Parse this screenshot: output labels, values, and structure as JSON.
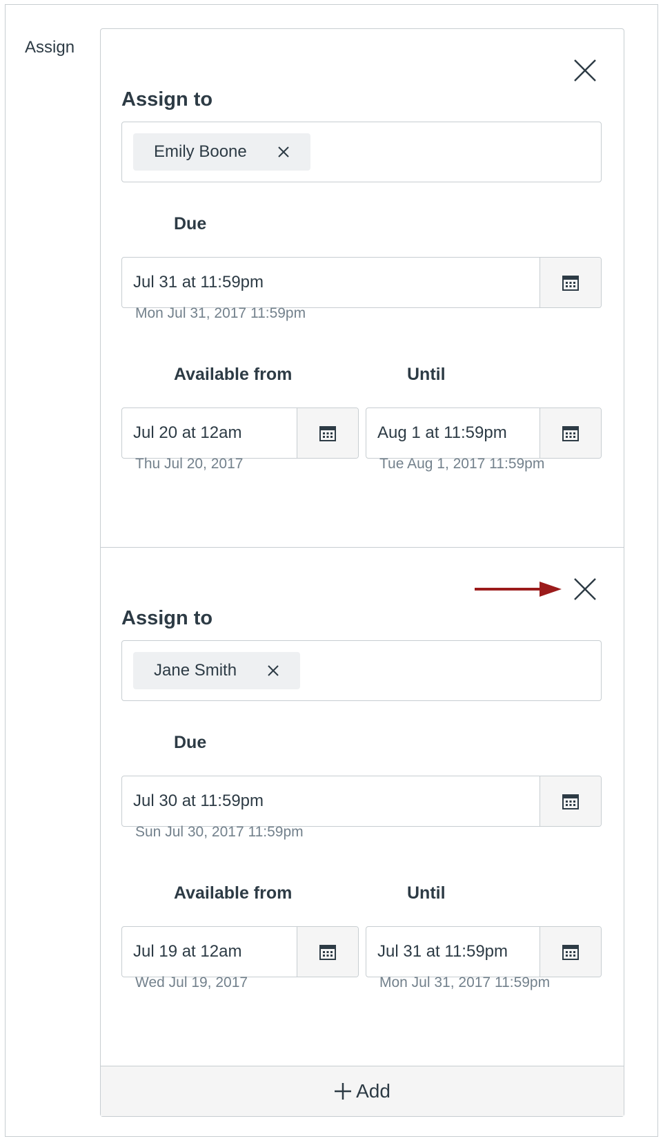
{
  "section_label": "Assign",
  "assignments": [
    {
      "title": "Assign to",
      "assignee": "Emily Boone",
      "due_label": "Due",
      "due_value": "Jul 31 at 11:59pm",
      "due_hint": "Mon Jul 31, 2017 11:59pm",
      "available_label": "Available from",
      "available_value": "Jul 20 at 12am",
      "available_hint": "Thu Jul 20, 2017",
      "until_label": "Until",
      "until_value": "Aug 1 at 11:59pm",
      "until_hint": "Tue Aug 1, 2017 11:59pm"
    },
    {
      "title": "Assign to",
      "assignee": "Jane Smith",
      "due_label": "Due",
      "due_value": "Jul 30 at 11:59pm",
      "due_hint": "Sun Jul 30, 2017 11:59pm",
      "available_label": "Available from",
      "available_value": "Jul 19 at 12am",
      "available_hint": "Wed Jul 19, 2017",
      "until_label": "Until",
      "until_value": "Jul 31 at 11:59pm",
      "until_hint": "Mon Jul 31, 2017 11:59pm"
    }
  ],
  "add_label": "Add",
  "icons": {
    "close": "close-icon",
    "calendar": "calendar-icon",
    "plus": "plus-icon",
    "arrow": "arrow-right-icon"
  },
  "colors": {
    "text": "#2d3b45",
    "muted": "#73818c",
    "border": "#c7cdd1",
    "arrow": "#9b1b1b"
  }
}
